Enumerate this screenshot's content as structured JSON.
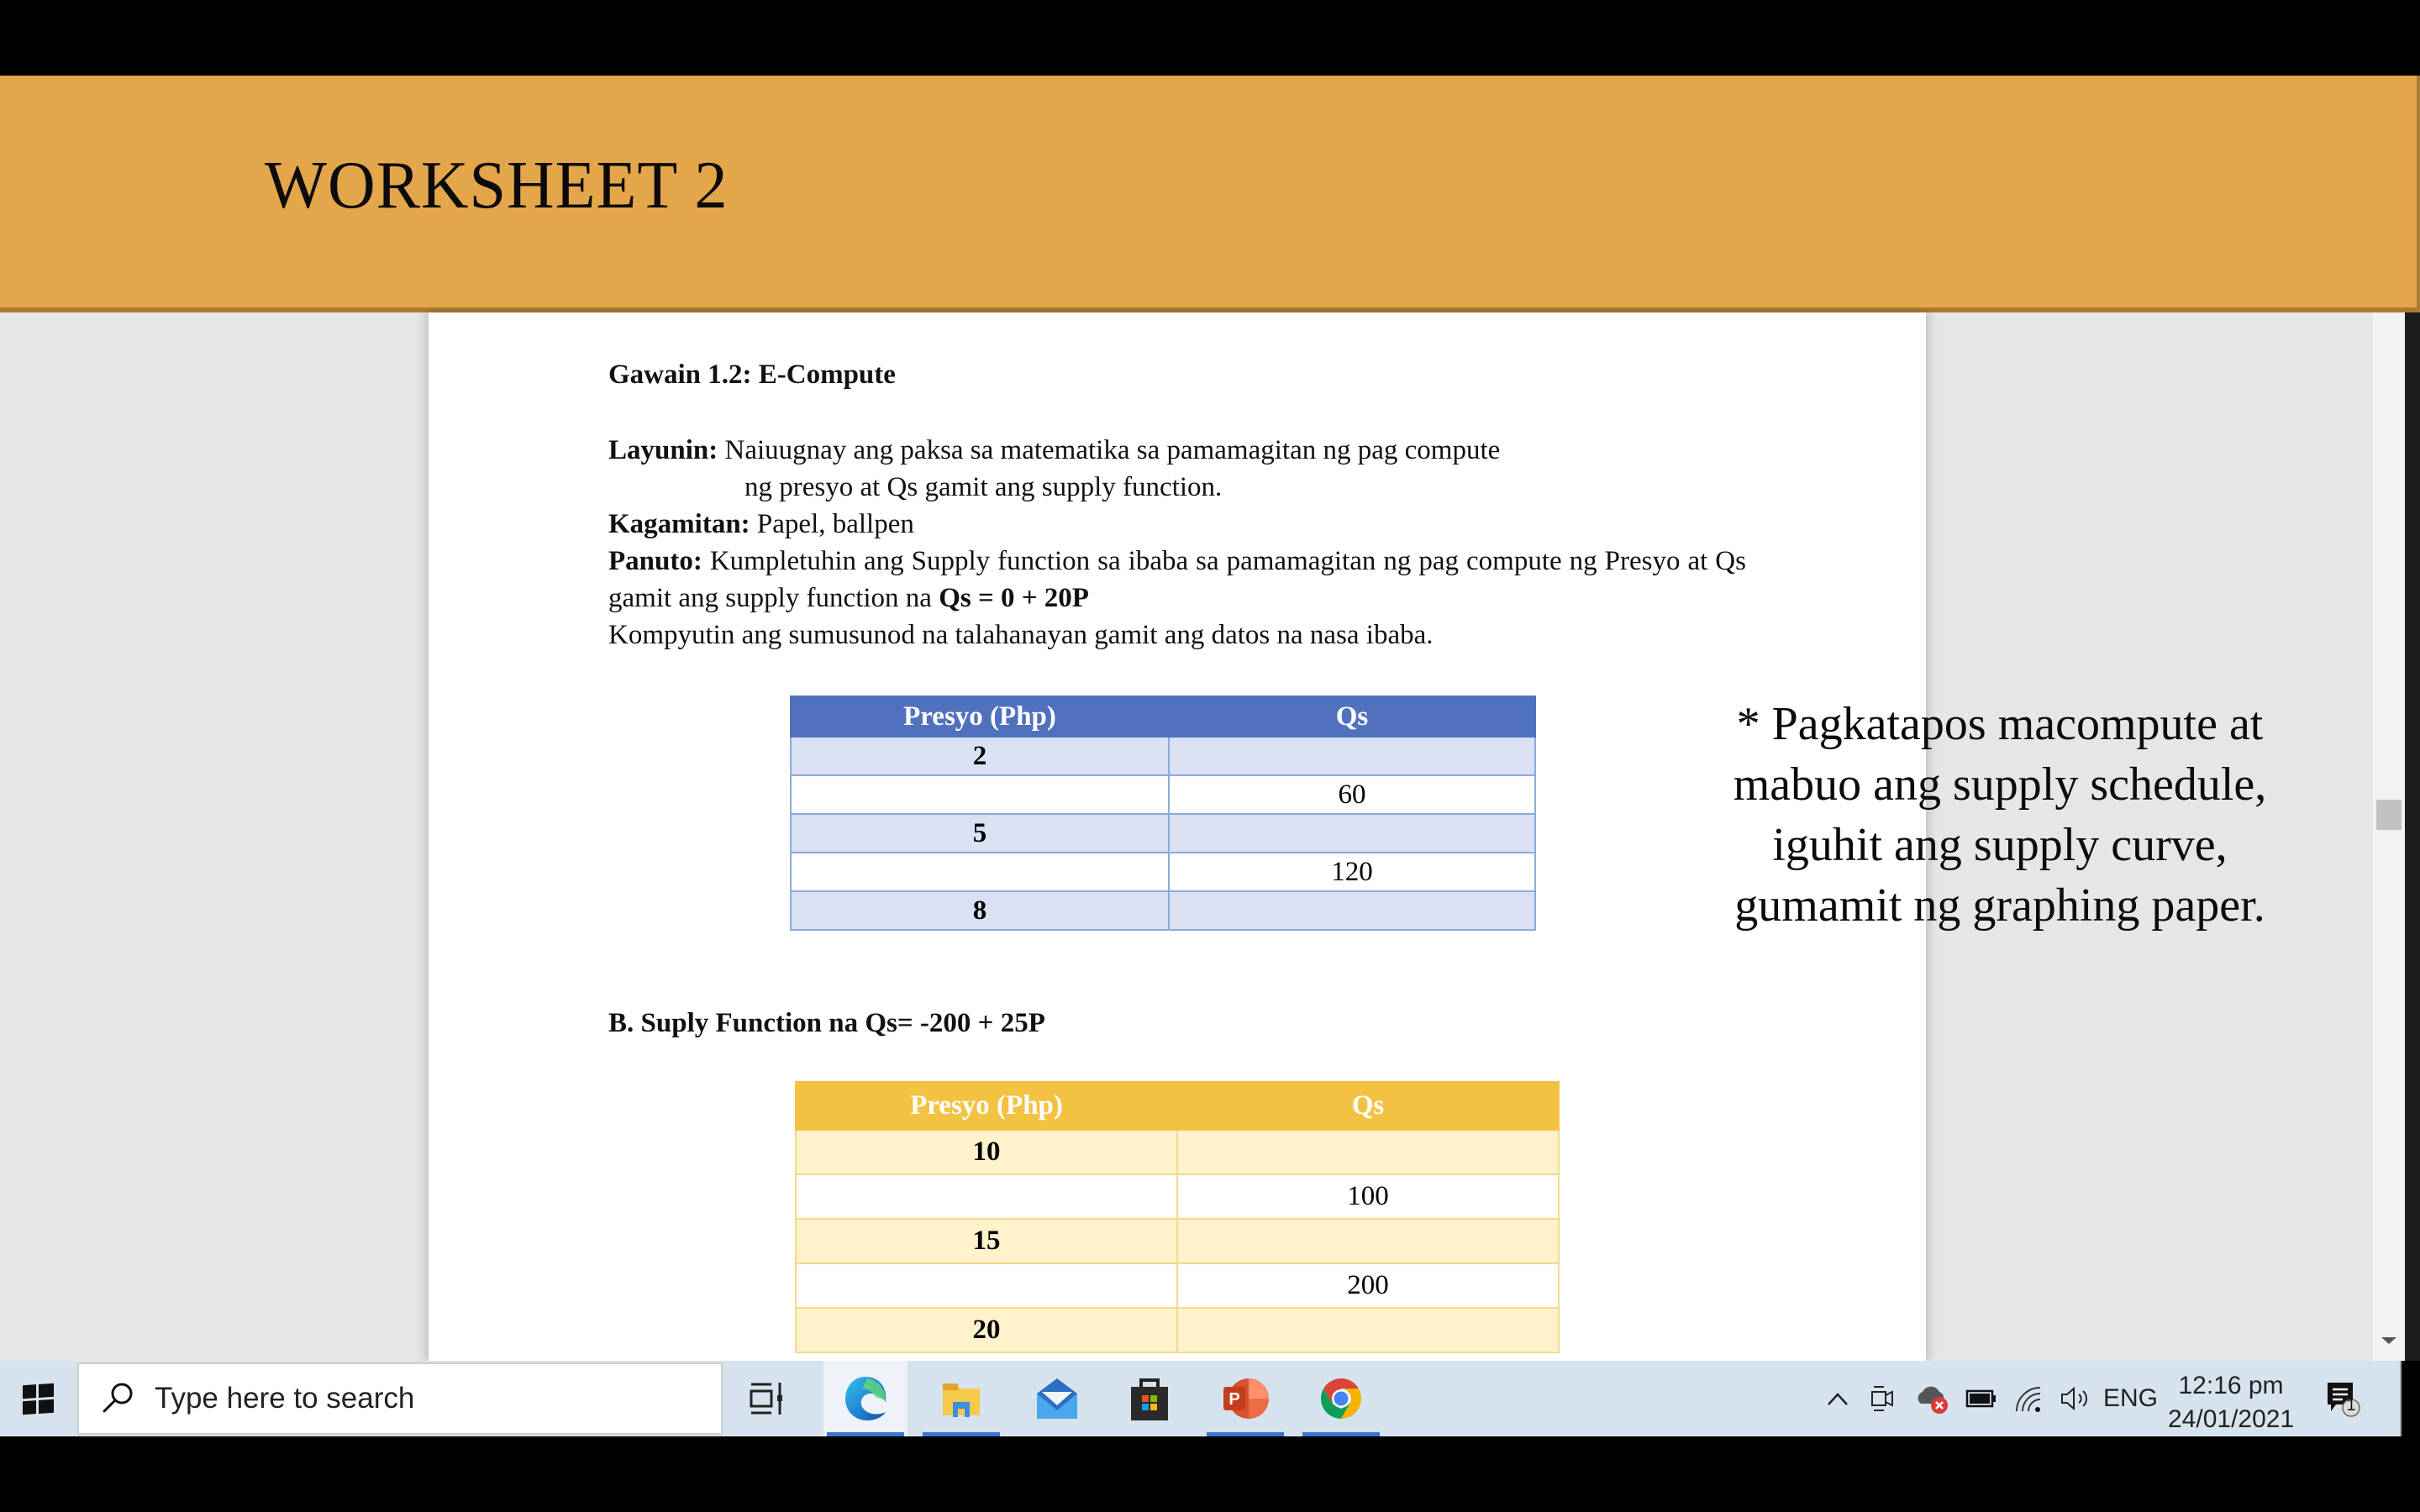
{
  "header": {
    "title": "WORKSHEET 2",
    "accent_color": "#e4a64a"
  },
  "document": {
    "activity_title": "Gawain 1.2: E-Compute",
    "objective": {
      "label": "Layunin:",
      "line1": " Naiuugnay ang paksa sa matematika sa pamamagitan ng pag compute",
      "line2": "ng presyo at Qs gamit ang supply function."
    },
    "materials": {
      "label": "Kagamitan:",
      "text": " Papel, ballpen"
    },
    "instructions": {
      "label": "Panuto:",
      "text": " Kumpletuhin ang Supply function sa ibaba sa pamamagitan ng pag compute ng Presyo at Qs gamit ang supply function na ",
      "formula": "Qs = 0 + 20P"
    },
    "compute_line": "Kompyutin ang sumusunod na talahanayan gamit ang datos na nasa ibaba.",
    "table_a": {
      "header_color": "#4f71be",
      "columns": [
        "Presyo (Php)",
        "Qs"
      ],
      "rows": [
        {
          "price": "2",
          "qs": ""
        },
        {
          "price": "",
          "qs": "60"
        },
        {
          "price": "5",
          "qs": ""
        },
        {
          "price": "",
          "qs": "120"
        },
        {
          "price": "8",
          "qs": ""
        }
      ]
    },
    "section_b_title": "B. Suply Function na Qs= -200 + 25P",
    "table_b": {
      "header_color": "#f4c242",
      "columns": [
        "Presyo (Php)",
        "Qs"
      ],
      "rows": [
        {
          "price": "10",
          "qs": ""
        },
        {
          "price": "",
          "qs": "100"
        },
        {
          "price": "15",
          "qs": ""
        },
        {
          "price": "",
          "qs": "200"
        },
        {
          "price": "20",
          "qs": ""
        }
      ]
    }
  },
  "side_note": {
    "lines": [
      "* Pagkatapos macompute at",
      "mabuo ang supply schedule,",
      "iguhit ang supply curve,",
      "gumamit ng graphing paper."
    ]
  },
  "taskbar": {
    "search_placeholder": "Type here to search",
    "apps": [
      {
        "name": "edge",
        "icon": "edge-icon",
        "active": true,
        "running": true
      },
      {
        "name": "file-explorer",
        "icon": "folder-icon",
        "active": false,
        "running": true
      },
      {
        "name": "mail",
        "icon": "mail-icon",
        "active": false,
        "running": false
      },
      {
        "name": "microsoft-store",
        "icon": "store-icon",
        "active": false,
        "running": false
      },
      {
        "name": "powerpoint",
        "icon": "powerpoint-icon",
        "active": false,
        "running": true
      },
      {
        "name": "chrome",
        "icon": "chrome-icon",
        "active": false,
        "running": true
      }
    ],
    "language": "ENG",
    "time": "12:16 pm",
    "date": "24/01/2021",
    "notification_count": "1"
  }
}
